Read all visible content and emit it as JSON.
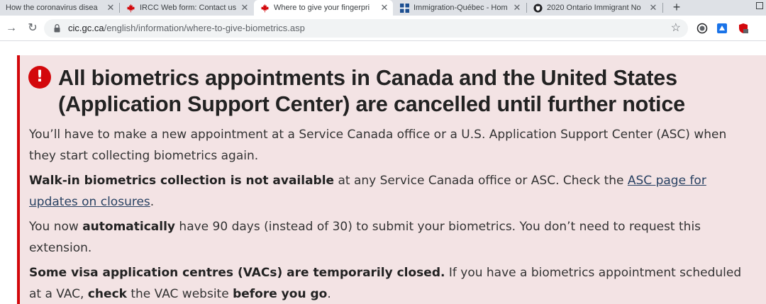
{
  "browser": {
    "tabs": [
      {
        "title": "How the coronavirus disea",
        "favicon": "document-icon",
        "active": false
      },
      {
        "title": "IRCC Web form: Contact us",
        "favicon": "maple-leaf-icon",
        "active": false
      },
      {
        "title": "Where to give your fingerpri",
        "favicon": "maple-leaf-icon",
        "active": true
      },
      {
        "title": "Immigration-Québec - Hom",
        "favicon": "fleur-de-lis-icon",
        "active": false
      },
      {
        "title": "2020 Ontario Immigrant No",
        "favicon": "shield-icon",
        "active": false
      }
    ],
    "new_tab_label": "+",
    "url_host": "cic.gc.ca",
    "url_path": "/english/information/where-to-give-biometrics.asp",
    "colors": {
      "tabstrip": "#dee1e6",
      "canada_red": "#d3080c"
    }
  },
  "alert": {
    "heading": "All biometrics appointments in Canada and the United States (Application Support Center) are cancelled until further notice",
    "p1": "You’ll have to make a new appointment at a Service Canada office or a U.S. Application Support Center (ASC) when they start collecting biometrics again.",
    "p2_bold": "Walk-in biometrics collection is not available",
    "p2_text": " at any Service Canada office or ASC. Check the ",
    "p2_link": "ASC page for updates on closures",
    "p2_end": ".",
    "p3_start": "You now ",
    "p3_bold": "automatically",
    "p3_text": " have 90 days (instead of 30) to submit your biometrics. You don’t need to request this extension.",
    "p4_bold": "Some visa application centres (VACs) are temporarily closed.",
    "p4_text": " If you have a biometrics appointment scheduled at a VAC, ",
    "p4_bold2": "check",
    "p4_text2": " the VAC website ",
    "p4_bold3": "before you go",
    "p4_end": ".",
    "colors": {
      "background": "#f3e3e4",
      "border": "#d3080c",
      "link": "#284162"
    }
  }
}
